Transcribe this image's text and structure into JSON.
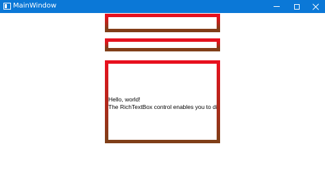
{
  "window": {
    "title": "MainWindow",
    "titlebar_color": "#0b78d7",
    "caption_buttons": [
      "minimize-icon",
      "maximize-icon",
      "close-icon"
    ]
  },
  "rich_text_boxes": [
    {
      "paragraphs": []
    },
    {
      "paragraphs": []
    },
    {
      "paragraphs": [
        "Hello, world!",
        "The RichTextBox control enables you to displ"
      ]
    }
  ],
  "colors": {
    "border_gradient_top": "#e8101e",
    "border_gradient_bottom": "#7f3e18"
  }
}
